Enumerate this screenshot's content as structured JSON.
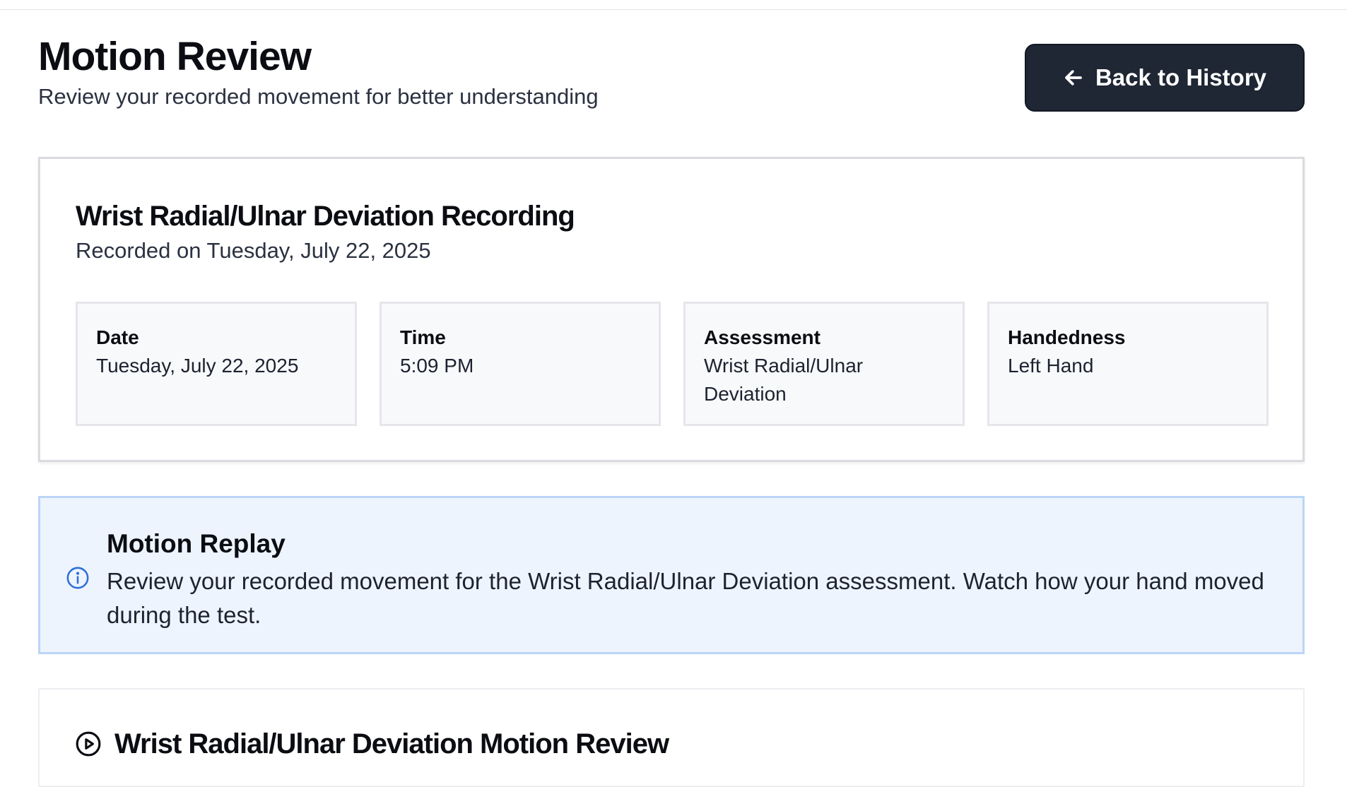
{
  "header": {
    "title": "Motion Review",
    "subtitle": "Review your recorded movement for better understanding",
    "back_button_label": "Back to History"
  },
  "recording": {
    "title": "Wrist Radial/Ulnar Deviation Recording",
    "subtitle": "Recorded on Tuesday, July 22, 2025",
    "details": [
      {
        "label": "Date",
        "value": "Tuesday, July 22, 2025"
      },
      {
        "label": "Time",
        "value": "5:09 PM"
      },
      {
        "label": "Assessment",
        "value": "Wrist Radial/Ulnar Deviation"
      },
      {
        "label": "Handedness",
        "value": "Left Hand"
      }
    ]
  },
  "notice": {
    "icon": "info-icon",
    "title": "Motion Replay",
    "body": "Review your recorded movement for the Wrist Radial/Ulnar Deviation assessment. Watch how your hand moved during the test."
  },
  "motion_review": {
    "icon": "play-circle-icon",
    "title": "Wrist Radial/Ulnar Deviation Motion Review"
  },
  "colors": {
    "button_bg": "#1f2634",
    "notice_bg": "#edf4fe",
    "notice_border": "#bcd5f7",
    "info_icon": "#2f6fd6"
  }
}
